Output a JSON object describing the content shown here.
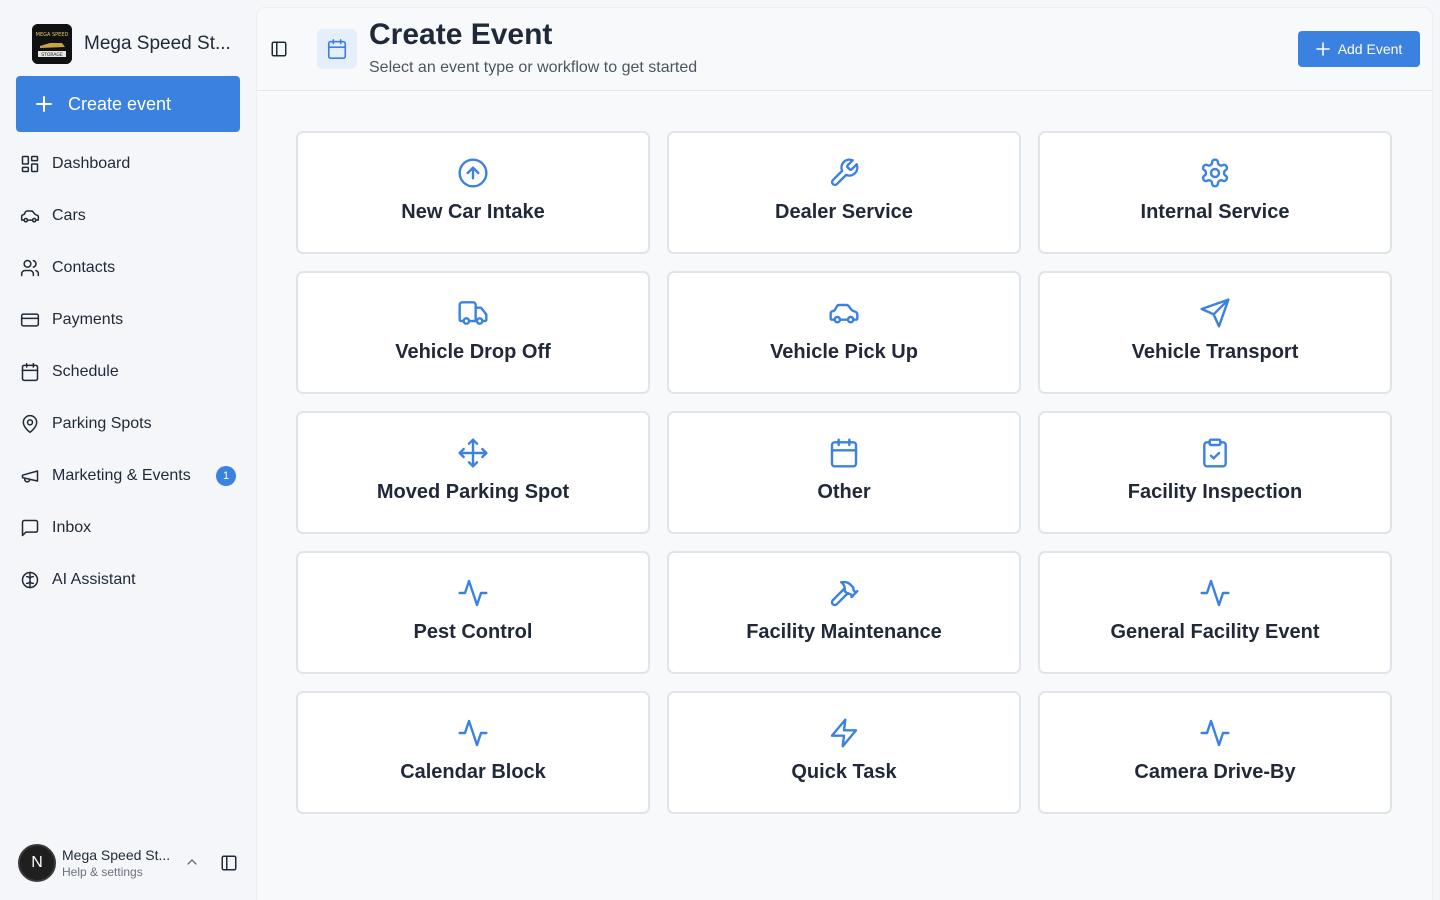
{
  "sidebar": {
    "brand_name": "Mega Speed St...",
    "brand_logo_text": "MEGA SPEED STORAGE",
    "create_label": "Create event",
    "items": [
      {
        "label": "Dashboard",
        "icon": "dashboard-icon"
      },
      {
        "label": "Cars",
        "icon": "car-icon"
      },
      {
        "label": "Contacts",
        "icon": "users-icon"
      },
      {
        "label": "Payments",
        "icon": "credit-card-icon"
      },
      {
        "label": "Schedule",
        "icon": "calendar-icon"
      },
      {
        "label": "Parking Spots",
        "icon": "map-pin-icon"
      },
      {
        "label": "Marketing & Events",
        "icon": "megaphone-icon",
        "badge": "1"
      },
      {
        "label": "Inbox",
        "icon": "message-square-icon"
      },
      {
        "label": "AI Assistant",
        "icon": "brain-icon"
      }
    ],
    "user": {
      "initial": "N",
      "name": "Mega Speed St...",
      "sub": "Help & settings"
    }
  },
  "header": {
    "title": "Create Event",
    "subtitle": "Select an event type or workflow to get started",
    "add_label": "Add Event"
  },
  "cards": [
    {
      "label": "New Car Intake",
      "icon": "arrow-up-circle-icon"
    },
    {
      "label": "Dealer Service",
      "icon": "wrench-icon"
    },
    {
      "label": "Internal Service",
      "icon": "gear-icon"
    },
    {
      "label": "Vehicle Drop Off",
      "icon": "truck-icon"
    },
    {
      "label": "Vehicle Pick Up",
      "icon": "car-icon"
    },
    {
      "label": "Vehicle Transport",
      "icon": "navigation-icon"
    },
    {
      "label": "Moved Parking Spot",
      "icon": "move-icon"
    },
    {
      "label": "Other",
      "icon": "calendar-icon"
    },
    {
      "label": "Facility Inspection",
      "icon": "clipboard-check-icon"
    },
    {
      "label": "Pest Control",
      "icon": "activity-icon"
    },
    {
      "label": "Facility Maintenance",
      "icon": "hammer-icon"
    },
    {
      "label": "General Facility Event",
      "icon": "activity-icon"
    },
    {
      "label": "Calendar Block",
      "icon": "activity-icon"
    },
    {
      "label": "Quick Task",
      "icon": "zap-icon"
    },
    {
      "label": "Camera Drive-By",
      "icon": "activity-icon"
    }
  ],
  "colors": {
    "accent": "#3b82e0",
    "background": "#f4f6f9",
    "card_border": "#e1e4e9",
    "text": "#1f2937"
  }
}
